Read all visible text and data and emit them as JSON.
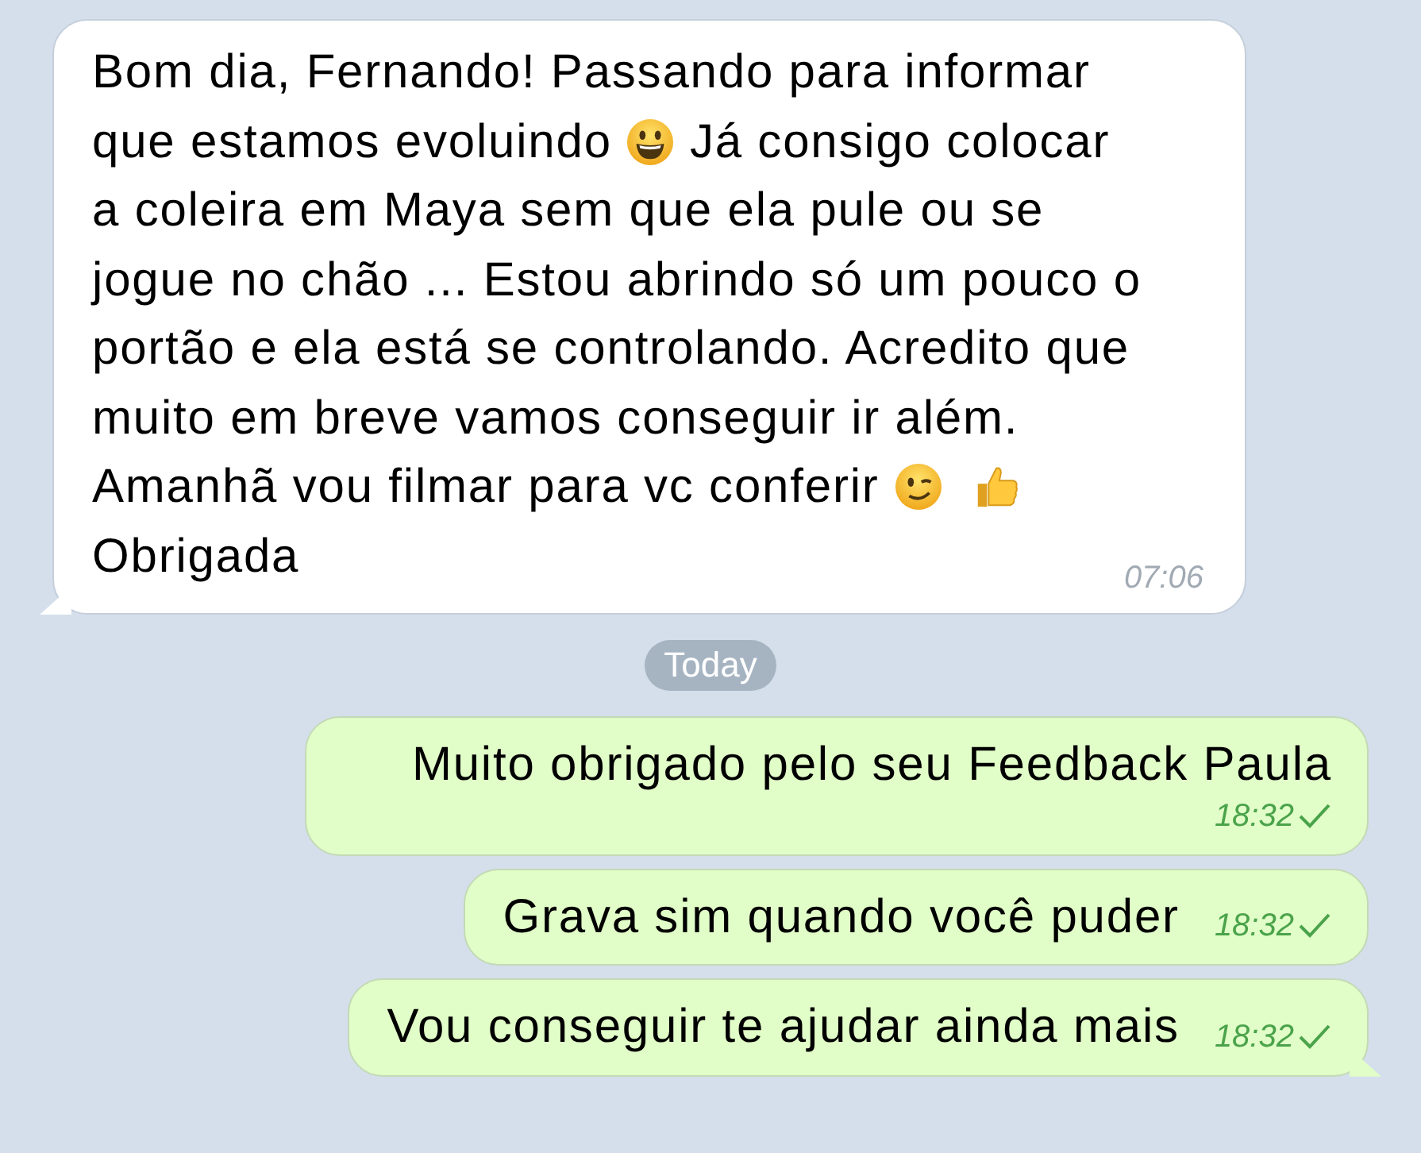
{
  "messages": [
    {
      "kind": "incoming",
      "lines": [
        [
          {
            "kind": "text",
            "text": "Bom dia, Fernando! Passando para informar"
          }
        ],
        [
          {
            "kind": "text",
            "text": "que estamos evoluindo"
          },
          {
            "kind": "smiley"
          },
          {
            "kind": "text",
            "text": "Já consigo colocar"
          }
        ],
        [
          {
            "kind": "text",
            "text": "a coleira em Maya sem que ela pule ou se"
          }
        ],
        [
          {
            "kind": "text",
            "text": "jogue no chão ... Estou abrindo só um pouco o"
          }
        ],
        [
          {
            "kind": "text",
            "text": "portão e ela está se controlando. Acredito que"
          }
        ],
        [
          {
            "kind": "text",
            "text": "muito em breve vamos conseguir ir além."
          }
        ],
        [
          {
            "kind": "text",
            "text": "Amanhã vou filmar para vc conferir"
          },
          {
            "kind": "wink"
          },
          {
            "kind": "thumbsup"
          }
        ],
        [
          {
            "kind": "text",
            "text": "Obrigada"
          }
        ]
      ],
      "time": "07:06"
    },
    {
      "kind": "divider",
      "text": "Today"
    },
    {
      "kind": "outgoing",
      "lines": [
        [
          {
            "kind": "text",
            "text": "Muito obrigado pelo seu Feedback Paula"
          }
        ]
      ],
      "time": "18:32",
      "read": false
    },
    {
      "kind": "outgoing",
      "lines": [
        [
          {
            "kind": "text",
            "text": "Grava sim quando você puder"
          }
        ]
      ],
      "time": "18:32",
      "read": false
    },
    {
      "kind": "outgoing",
      "lines": [
        [
          {
            "kind": "text",
            "text": "Vou conseguir te ajudar ainda mais"
          }
        ]
      ],
      "time": "18:32",
      "read": false
    }
  ]
}
